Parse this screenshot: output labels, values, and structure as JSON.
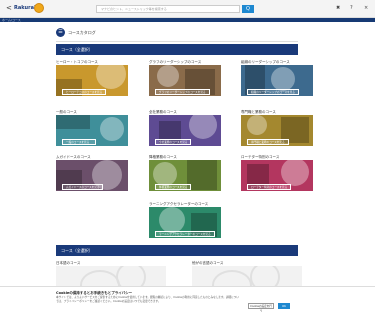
{
  "header": {
    "back_symbol": "<",
    "brand": "Rakuraku",
    "search_placeholder": "マナビのヒント、ニューストリック等を検索する",
    "search_button": "Q",
    "icons": [
      "bell-icon",
      "help-icon",
      "close-icon"
    ],
    "icon_glyphs": [
      "✖",
      "?",
      "×"
    ]
  },
  "nav": {
    "label": "ホーム/コース"
  },
  "page": {
    "icon_glyph": "☰",
    "title": "コースカタログ"
  },
  "sections": [
    {
      "title": "コース（全選択）"
    },
    {
      "title": "コース（全選択）"
    }
  ],
  "cards": [
    {
      "title": "ヒーロー・トコフのコース",
      "button": "ヒーローテコスのコースを見る",
      "color": "#c9982d"
    },
    {
      "title": "グラフのリーダーシップのコース",
      "button": "グラフのリーダーシップのコースを見る",
      "color": "#8a6b4a"
    },
    {
      "title": "組織のリーダーシップのコース",
      "button": "組織のリーダーシップのコースを見る",
      "color": "#3d6a8e"
    },
    {
      "title": "一般のコース",
      "button": "一般のコースを見る",
      "color": "#3f8f9a"
    },
    {
      "title": "全社業務のコース",
      "button": "全社業務のコースを見る",
      "color": "#5e4b93"
    },
    {
      "title": "専門職と業務のコース",
      "button": "専門職と業務のコースを見る",
      "color": "#a4882f"
    },
    {
      "title": "ムガイドースのコース",
      "button": "ムガイドースのコースを見る",
      "color": "#6b4f6a"
    },
    {
      "title": "降格業務のコース",
      "button": "降格業務のコースを見る",
      "color": "#6f8f3a"
    },
    {
      "title": "ローテター特別のコース",
      "button": "ローテター特別のコースを見る",
      "color": "#b3365f"
    },
    {
      "title": "ラーニングアクセラレーターのコース",
      "button": "ラーニングアクセラレーターのコースを見る",
      "color": "#2c8a6a"
    }
  ],
  "bottom_cards": [
    {
      "title": "日本語のコース"
    },
    {
      "title": "他がの言語のコース"
    }
  ],
  "cookie": {
    "title": "Cookieの保持するとお手続きもとプライバシー",
    "body": "本サイトでは、よりよいサービスをご提供するためにCookieを使用しています。閲覧の継続により、Cookieの利用に同意したものとみなします。詳細については、プライバシーポリシーをご確認ください。Cookieの設定はいつでも変更できます。",
    "settings_button": "Cookieの設定を行う",
    "accept_button": "OK"
  }
}
